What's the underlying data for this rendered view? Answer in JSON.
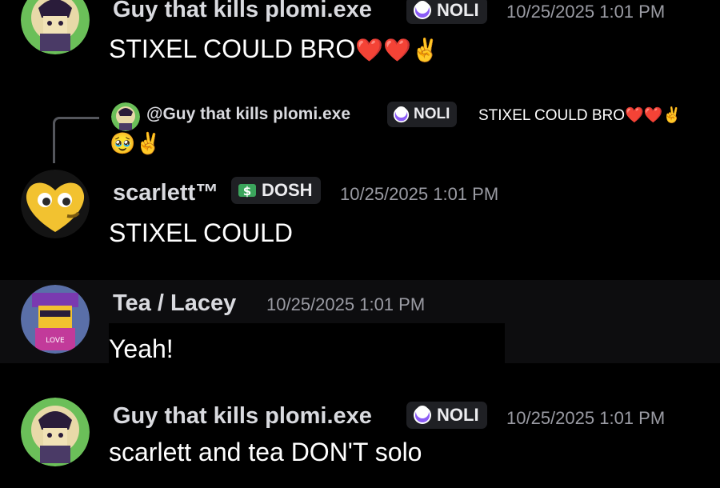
{
  "messages": [
    {
      "author": "Guy that kills plomi.exe",
      "tag": "NOLI",
      "tag_icon": "crescent-moon-icon",
      "timestamp": "10/25/2025 1:01 PM",
      "text": "STIXEL COULD BRO",
      "emoji": "❤️❤️✌️"
    },
    {
      "reply": {
        "author": "@Guy that kills plomi.exe",
        "tag": "NOLI",
        "text": "STIXEL COULD BRO❤️❤️✌️",
        "emoji": "🥹✌️"
      },
      "author": "scarlett™",
      "tag": "DOSH",
      "tag_icon": "dollar-sign-icon",
      "timestamp": "10/25/2025 1:01 PM",
      "text": "STIXEL COULD"
    },
    {
      "author": "Tea / Lacey",
      "timestamp": "10/25/2025 1:01 PM",
      "text": "Yeah!"
    },
    {
      "author": "Guy that kills plomi.exe",
      "tag": "NOLI",
      "tag_icon": "crescent-moon-icon",
      "timestamp": "10/25/2025 1:01 PM",
      "text": "scarlett and tea DON'T solo"
    }
  ],
  "colors": {
    "background": "#000000",
    "hover_background": "#0d0d0f",
    "username": "#d9dadf",
    "timestamp": "#9a9ba3",
    "tag_background": "#1f2024",
    "noli_icon": "#8b5cf6",
    "dosh_icon": "#3ba55c"
  }
}
